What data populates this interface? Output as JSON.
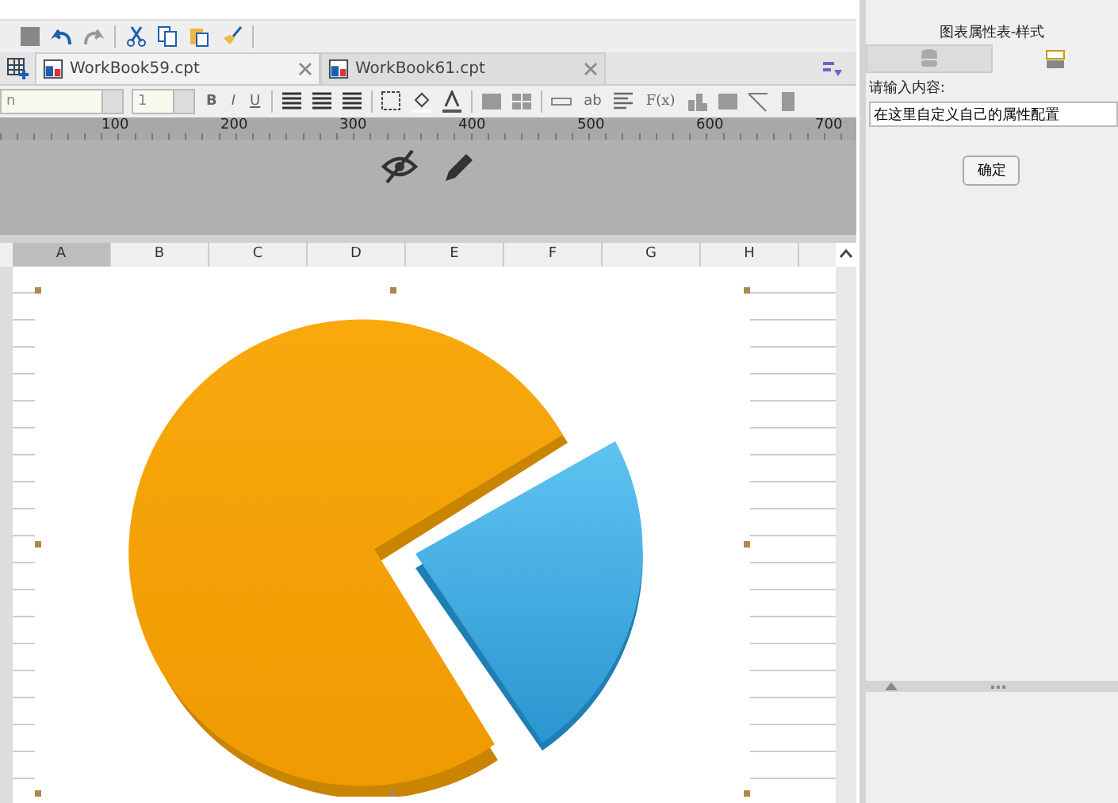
{
  "tabs": [
    {
      "label": "WorkBook59.cpt",
      "selected": true
    },
    {
      "label": "WorkBook61.cpt",
      "selected": false
    }
  ],
  "format_bar": {
    "font_field": "n",
    "size_field": "1",
    "text_buttons": [
      "B",
      "I",
      "U"
    ],
    "other_text_buttons": [
      "ab",
      "F(x)"
    ]
  },
  "ruler": [
    "100",
    "200",
    "300",
    "400",
    "500",
    "600",
    "700"
  ],
  "columns": [
    {
      "label": "A",
      "selected": true
    },
    {
      "label": "B",
      "selected": false
    },
    {
      "label": "C",
      "selected": false
    },
    {
      "label": "D",
      "selected": false
    },
    {
      "label": "E",
      "selected": false
    },
    {
      "label": "F",
      "selected": false
    },
    {
      "label": "G",
      "selected": false
    },
    {
      "label": "H",
      "selected": false
    }
  ],
  "panel": {
    "title": "图表属性表-样式",
    "tabs": [
      {
        "kind": "data",
        "selected": false
      },
      {
        "kind": "style",
        "selected": true
      }
    ],
    "label": "请输入内容:",
    "input": "在这里自定义自己的属性配置",
    "button": "确定"
  }
}
